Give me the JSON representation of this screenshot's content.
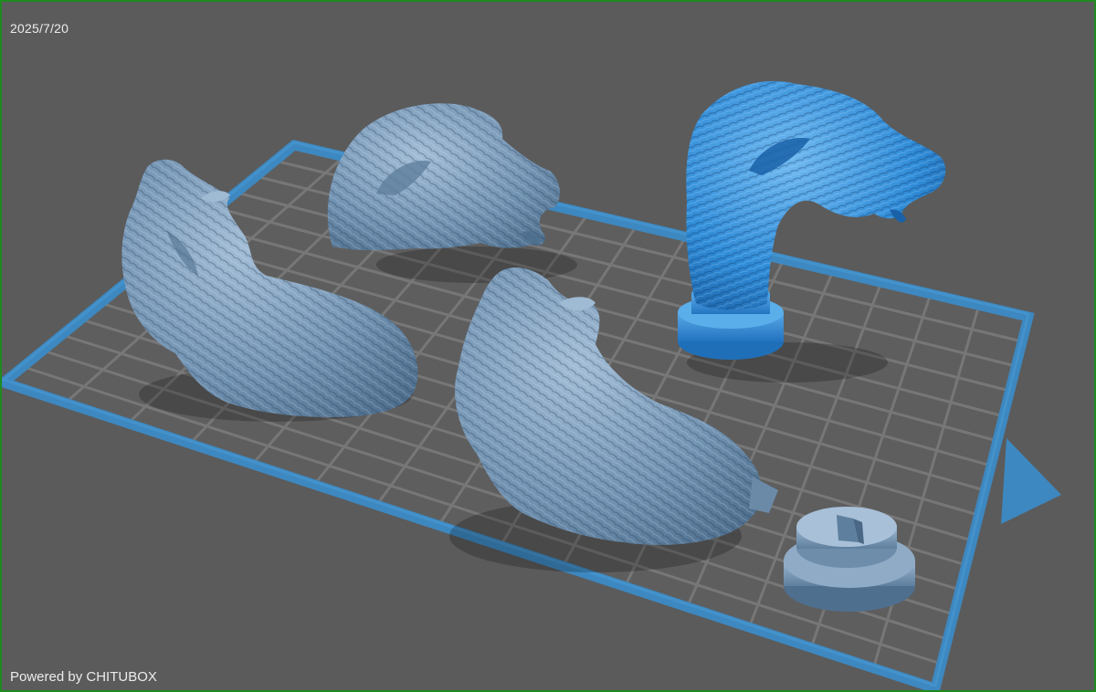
{
  "viewport": {
    "date_stamp": "2025/7/20",
    "watermark": "Powered by CHITUBOX"
  },
  "colors": {
    "background": "#5b5b5b",
    "grid_line": "#757575",
    "platform_border": "#3d88c0",
    "model_default": "#7496b5",
    "model_selected": "#2f8cd8",
    "frame": "#1e8a1e"
  },
  "scene": {
    "models": [
      {
        "name": "dog-head-bust",
        "selected": false
      },
      {
        "name": "dog-body-back-left",
        "selected": false
      },
      {
        "name": "dog-body-front",
        "selected": false
      },
      {
        "name": "dog-head-on-base",
        "selected": true
      },
      {
        "name": "round-base",
        "selected": false
      }
    ]
  }
}
